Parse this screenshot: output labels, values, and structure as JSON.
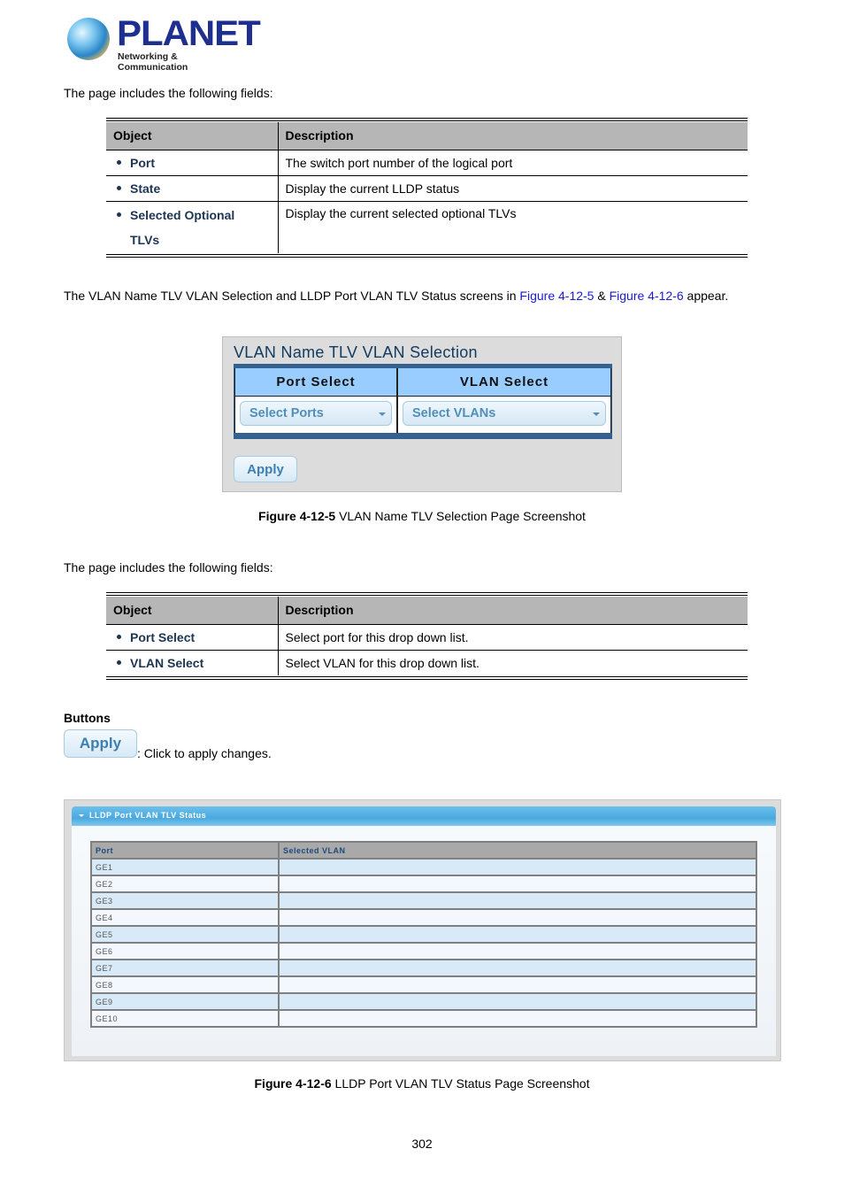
{
  "logo": {
    "brand": "PLANET",
    "tagline": "Networking & Communication"
  },
  "intro1": "The page includes the following fields:",
  "table1": {
    "headers": [
      "Object",
      "Description"
    ],
    "rows": [
      {
        "object": "Port",
        "description": "The switch port number of the logical port"
      },
      {
        "object": "State",
        "description": "Display the current LLDP status"
      },
      {
        "object_line1": "Selected Optional",
        "object_line2": "TLVs",
        "description": "Display the current selected optional TLVs"
      }
    ]
  },
  "para2": {
    "text1": "The VLAN Name TLV VLAN Selection and LLDP Port VLAN TLV Status screens in ",
    "link1": "Figure 4-12-5",
    "text2": " & ",
    "link2": "Figure 4-12-6",
    "text3": " appear."
  },
  "figure5": {
    "title": "VLAN Name TLV VLAN Selection",
    "col1": "Port Select",
    "col2": "VLAN Select",
    "port_select_value": "Select Ports",
    "vlan_select_value": "Select VLANs",
    "apply_label": "Apply",
    "caption_bold": "Figure 4-12-5",
    "caption_text": " VLAN Name TLV Selection Page Screenshot"
  },
  "intro2": "The page includes the following fields:",
  "table2": {
    "headers": [
      "Object",
      "Description"
    ],
    "rows": [
      {
        "object": "Port Select",
        "description": "Select port for this drop down list."
      },
      {
        "object": "VLAN Select",
        "description": "Select VLAN for this drop down list."
      }
    ]
  },
  "buttons": {
    "heading": "Buttons",
    "apply_label": "Apply",
    "apply_desc": ": Click to apply changes."
  },
  "figure6": {
    "panel_title": "LLDP Port VLAN TLV Status",
    "headers": [
      "Port",
      "Selected VLAN"
    ],
    "rows": [
      {
        "port": "GE1",
        "vlan": ""
      },
      {
        "port": "GE2",
        "vlan": ""
      },
      {
        "port": "GE3",
        "vlan": ""
      },
      {
        "port": "GE4",
        "vlan": ""
      },
      {
        "port": "GE5",
        "vlan": ""
      },
      {
        "port": "GE6",
        "vlan": ""
      },
      {
        "port": "GE7",
        "vlan": ""
      },
      {
        "port": "GE8",
        "vlan": ""
      },
      {
        "port": "GE9",
        "vlan": ""
      },
      {
        "port": "GE10",
        "vlan": ""
      }
    ],
    "caption_bold": "Figure 4-12-6",
    "caption_text": " LLDP Port VLAN TLV Status Page Screenshot"
  },
  "page_number": "302",
  "colors": {
    "link": "#1a1ad6",
    "object_text": "#1c3553",
    "header_bar": "#4aa9df",
    "select_text": "#4f8fba"
  }
}
